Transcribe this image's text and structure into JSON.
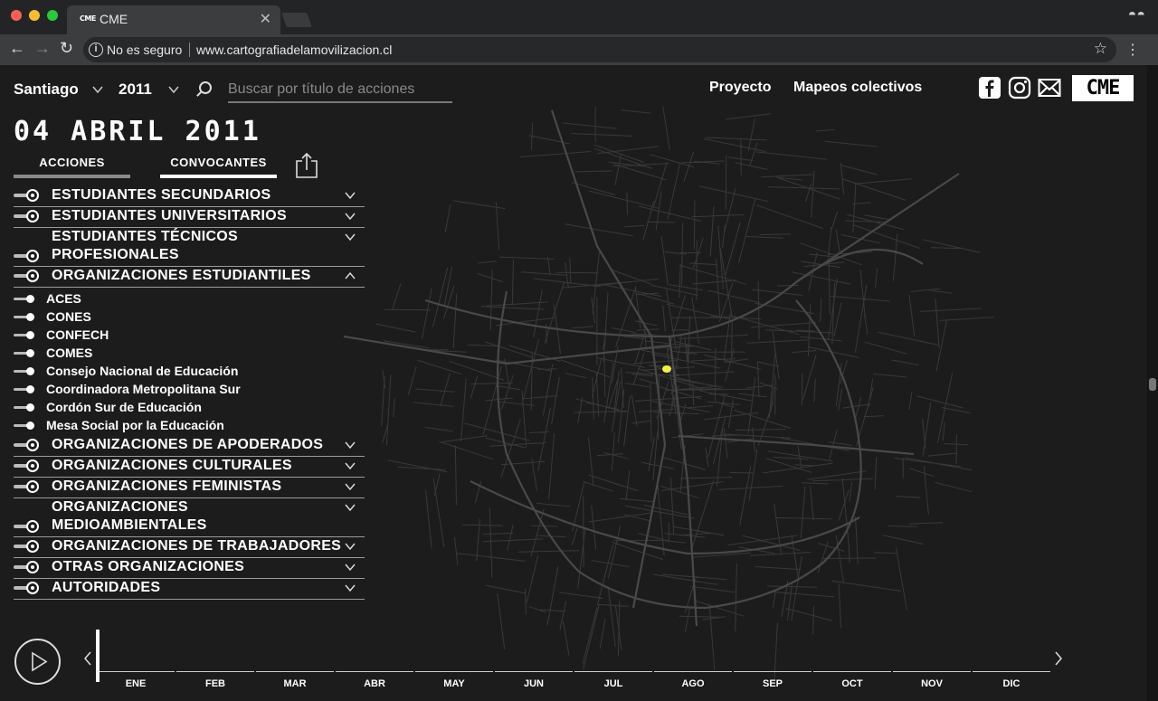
{
  "browser": {
    "tab_favicon": "CME",
    "tab_title": "CME",
    "insecure_label": "No es seguro",
    "url": "www.cartografiadelamovilizacion.cl"
  },
  "header": {
    "city": "Santiago",
    "year": "2011",
    "search_placeholder": "Buscar por título de acciones",
    "nav": [
      "Proyecto",
      "Mapeos colectivos"
    ],
    "logo": "CME"
  },
  "date_title": "04 ABRIL 2011",
  "view_tabs": [
    "ACCIONES",
    "CONVOCANTES"
  ],
  "active_view_tab": "CONVOCANTES",
  "categories": [
    {
      "label": "ESTUDIANTES SECUNDARIOS"
    },
    {
      "label": "ESTUDIANTES UNIVERSITARIOS"
    },
    {
      "label": "ESTUDIANTES TÉCNICOS PROFESIONALES"
    },
    {
      "label": "ORGANIZACIONES ESTUDIANTILES",
      "expanded": true
    },
    {
      "label": "ORGANIZACIONES DE APODERADOS"
    },
    {
      "label": "ORGANIZACIONES CULTURALES"
    },
    {
      "label": "ORGANIZACIONES FEMINISTAS"
    },
    {
      "label": "ORGANIZACIONES MEDIOAMBIENTALES"
    },
    {
      "label": "ORGANIZACIONES DE TRABAJADORES"
    },
    {
      "label": "OTRAS ORGANIZACIONES"
    },
    {
      "label": "AUTORIDADES"
    }
  ],
  "subitems": [
    "ACES",
    "CONES",
    "CONFECH",
    "COMES",
    "Consejo Nacional de Educación",
    "Coordinadora Metropolitana Sur",
    "Cordón Sur de Educación",
    "Mesa Social por la Educación"
  ],
  "months": [
    "ENE",
    "FEB",
    "MAR",
    "ABR",
    "MAY",
    "JUN",
    "JUL",
    "AGO",
    "SEP",
    "OCT",
    "NOV",
    "DIC"
  ],
  "colors": {
    "accent_marker": "#f4f142",
    "background": "#1d1c1d"
  },
  "icons": [
    "search-icon",
    "facebook-icon",
    "instagram-icon",
    "mail-icon",
    "share-icon",
    "play-icon",
    "chevron-down-icon",
    "chevron-up-icon"
  ]
}
